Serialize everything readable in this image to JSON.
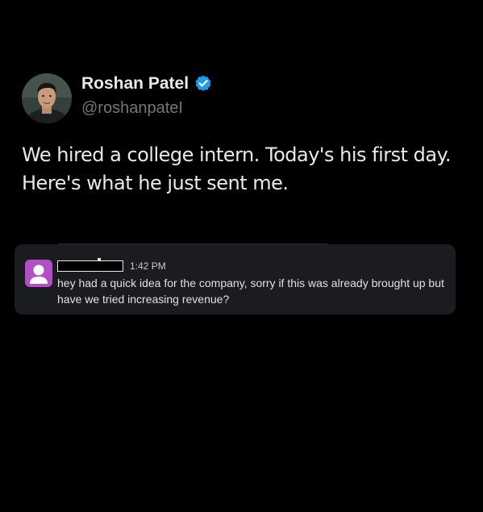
{
  "tweet": {
    "author": {
      "display_name": "Roshan Patel",
      "handle": "@roshanpateI",
      "avatar_icon": "profile-photo",
      "verified_icon": "verified-badge-icon",
      "verified_color": "#1d9bf0"
    },
    "text_lines": [
      "We hired a college intern. Today's his first day.",
      "Here's what he just sent me."
    ]
  },
  "chat_message": {
    "avatar_icon": "default-user-icon",
    "avatar_color": "#b34fc6",
    "timestamp": "1:42 PM",
    "text_lines": [
      "hey had a quick idea for the company, sorry if this was already brought up but",
      "have we tried increasing revenue?"
    ]
  },
  "colors": {
    "background": "#000000",
    "text_primary": "#e7e9ea",
    "text_secondary": "#71767b",
    "card_background": "#1b1c1f"
  }
}
